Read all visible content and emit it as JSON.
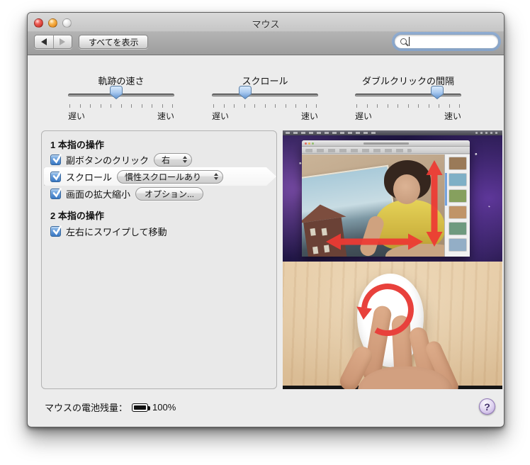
{
  "window": {
    "title": "マウス"
  },
  "toolbar": {
    "show_all_label": "すべてを表示",
    "search_value": ""
  },
  "icons": {
    "back": "left-arrow",
    "forward": "right-arrow",
    "search": "magnifier",
    "popup": "up-down-arrows",
    "checkbox": "checkmark",
    "battery": "battery-full",
    "help": "question-mark"
  },
  "sliders": {
    "tracking": {
      "title": "軌跡の速さ",
      "min_label": "遅い",
      "max_label": "速い",
      "percent": 45
    },
    "scrolling": {
      "title": "スクロール",
      "min_label": "遅い",
      "max_label": "速い",
      "percent": 31
    },
    "double_click": {
      "title": "ダブルクリックの間隔",
      "min_label": "遅い",
      "max_label": "速い",
      "percent": 77
    }
  },
  "gestures": {
    "section_one": {
      "heading": "1 本指の操作",
      "secondary_click": {
        "label": "副ボタンのクリック",
        "checked": true,
        "popup_value": "右"
      },
      "scroll": {
        "label": "スクロール",
        "checked": true,
        "popup_value": "慣性スクロールあり",
        "selected": true
      },
      "screen_zoom": {
        "label": "画面の拡大縮小",
        "checked": true,
        "button_label": "オプション..."
      }
    },
    "section_two": {
      "heading": "2 本指の操作",
      "swipe": {
        "label": "左右にスワイプして移動",
        "checked": true
      }
    }
  },
  "status": {
    "battery_label": "マウスの電池残量：",
    "battery_value": "100%",
    "help_label": "?"
  },
  "colors": {
    "accent_blue": "#3a78c2",
    "arrow_red": "#ee3a33",
    "help_purple": "#8f76b5"
  }
}
